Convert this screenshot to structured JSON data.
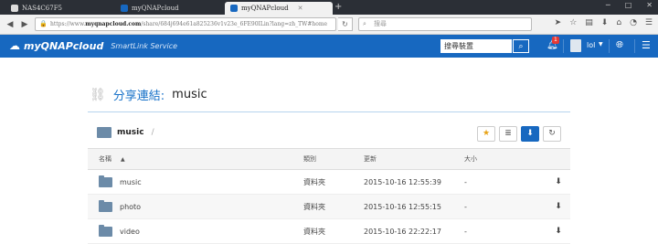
{
  "browser": {
    "tabs": [
      {
        "label": "NAS4C67F5",
        "active": false
      },
      {
        "label": "myQNAPcloud",
        "active": false
      },
      {
        "label": "myQNAPcloud",
        "active": true
      }
    ],
    "new_tab": "+",
    "url_prefix": "https://www.",
    "url_domain": "myqnapcloud.com",
    "url_rest": "/share/684j694e61a825236v1v23e_6FE90ILin?lang=zh_TW#home",
    "search_placeholder": "搜尋"
  },
  "app": {
    "brand": "myQNAPcloud",
    "subtitle": "SmartLink Service",
    "search_placeholder": "搜尋裝置",
    "notification_count": "1",
    "username": "lol"
  },
  "share": {
    "label": "分享連結:",
    "name": "music"
  },
  "folder": {
    "current": "music",
    "separator": "/"
  },
  "table": {
    "headers": {
      "name": "名稱",
      "type": "類別",
      "modified": "更新",
      "size": "大小"
    },
    "rows": [
      {
        "name": "music",
        "type": "資料夾",
        "modified": "2015-10-16 12:55:39",
        "size": "-"
      },
      {
        "name": "photo",
        "type": "資料夾",
        "modified": "2015-10-16 12:55:15",
        "size": "-"
      },
      {
        "name": "video",
        "type": "資料夾",
        "modified": "2015-10-16 22:22:17",
        "size": "-"
      }
    ]
  },
  "colors": {
    "appbar": "#1768c0",
    "accent": "#1a73c9"
  }
}
